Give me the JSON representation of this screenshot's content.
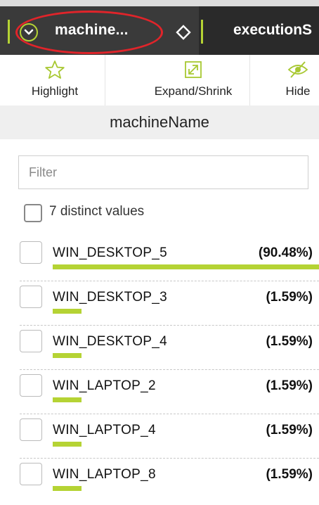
{
  "colors": {
    "accent": "#b5d334",
    "annotation": "#e0242a",
    "header_bg": "#2a2a2a"
  },
  "column_header": {
    "active_title": "machine...",
    "next_title": "executionS",
    "icons": [
      "chevron-down-icon",
      "diamond-sort-icon"
    ]
  },
  "toolbar": {
    "highlight_label": "Highlight",
    "expand_label": "Expand/Shrink",
    "hide_label": "Hide"
  },
  "field_name": "machineName",
  "filter": {
    "placeholder": "Filter",
    "value": ""
  },
  "distinct_label": "7 distinct values",
  "values": [
    {
      "name": "WIN_DESKTOP_5",
      "pct_text": "(90.48%)",
      "pct": 90.48
    },
    {
      "name": "WIN_DESKTOP_3",
      "pct_text": "(1.59%)",
      "pct": 1.59
    },
    {
      "name": "WIN_DESKTOP_4",
      "pct_text": "(1.59%)",
      "pct": 1.59
    },
    {
      "name": "WIN_LAPTOP_2",
      "pct_text": "(1.59%)",
      "pct": 1.59
    },
    {
      "name": "WIN_LAPTOP_4",
      "pct_text": "(1.59%)",
      "pct": 1.59
    },
    {
      "name": "WIN_LAPTOP_8",
      "pct_text": "(1.59%)",
      "pct": 1.59
    }
  ]
}
